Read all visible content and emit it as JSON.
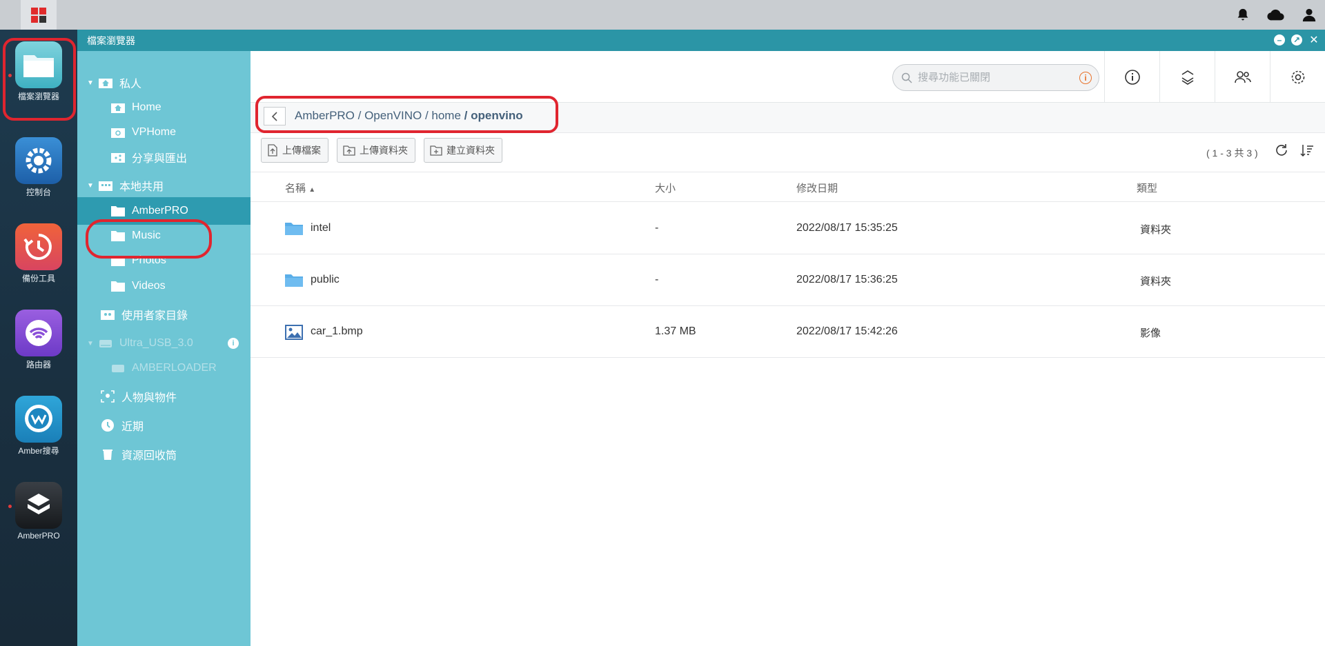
{
  "window": {
    "title": "檔案瀏覽器"
  },
  "dock": [
    {
      "label": "檔案瀏覽器",
      "icon": "file-browser-icon"
    },
    {
      "label": "控制台",
      "icon": "control-panel-icon"
    },
    {
      "label": "備份工具",
      "icon": "backup-icon"
    },
    {
      "label": "路由器",
      "icon": "router-icon"
    },
    {
      "label": "Amber搜尋",
      "icon": "amber-search-icon"
    },
    {
      "label": "AmberPRO",
      "icon": "amberpro-icon"
    }
  ],
  "sidebar": {
    "private": {
      "label": "私人",
      "items": [
        "Home",
        "VPHome",
        "分享與匯出"
      ]
    },
    "shared": {
      "label": "本地共用",
      "items": [
        "AmberPRO",
        "Music",
        "Photos",
        "Videos"
      ]
    },
    "user_home": "使用者家目錄",
    "usb": {
      "label": "Ultra_USB_3.0",
      "items": [
        "AMBERLOADER"
      ]
    },
    "people": "人物與物件",
    "recent": "近期",
    "recycle": "資源回收筒"
  },
  "search": {
    "placeholder": "搜尋功能已關閉"
  },
  "breadcrumb": {
    "path": "AmberPRO / OpenVINO / home",
    "current": "/ openvino"
  },
  "actions": {
    "upload_file": "上傳檔案",
    "upload_folder": "上傳資料夾",
    "create_folder": "建立資料夾"
  },
  "count": "( 1 - 3 共 3 )",
  "columns": {
    "name": "名稱",
    "size": "大小",
    "modified": "修改日期",
    "type": "類型"
  },
  "files": [
    {
      "name": "intel",
      "size": "-",
      "modified": "2022/08/17 15:35:25",
      "type": "資料夾",
      "icon": "folder-icon"
    },
    {
      "name": "public",
      "size": "-",
      "modified": "2022/08/17 15:36:25",
      "type": "資料夾",
      "icon": "folder-icon"
    },
    {
      "name": "car_1.bmp",
      "size": "1.37 MB",
      "modified": "2022/08/17 15:42:26",
      "type": "影像",
      "icon": "image-icon"
    }
  ],
  "colors": {
    "accent": "#2b95a6",
    "sidebar": "#6ec6d5",
    "selected": "#2e9bb0",
    "highlight": "#e0252f",
    "folder": "#5aaee8"
  }
}
